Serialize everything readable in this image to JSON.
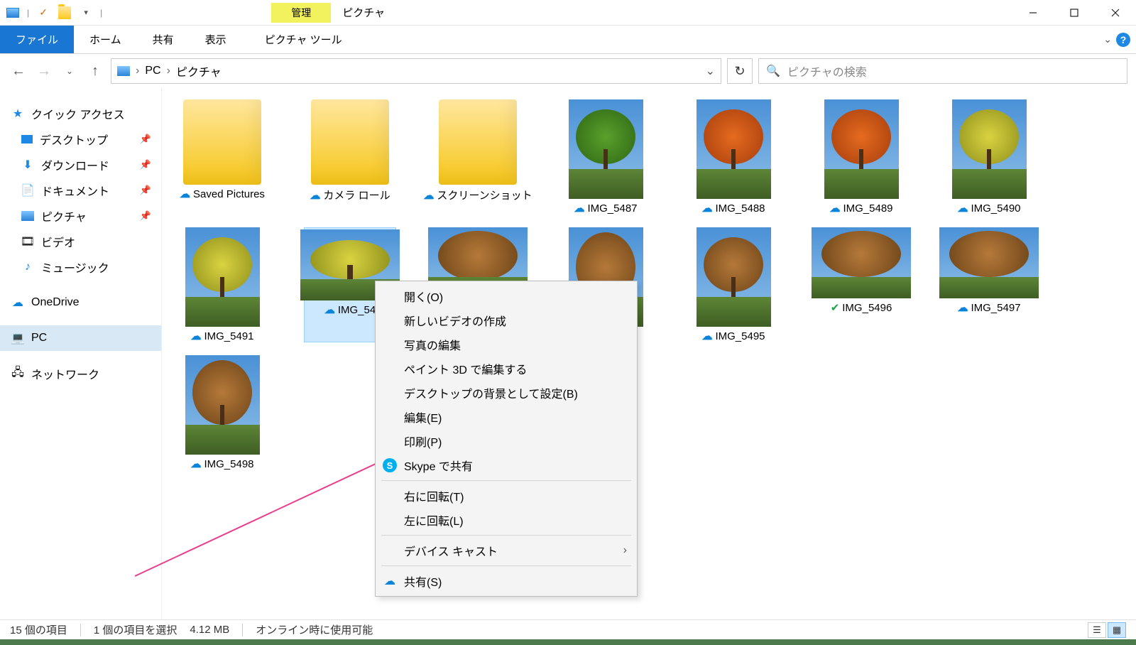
{
  "window": {
    "title": "ピクチャ",
    "contextual_tab": "管理",
    "tools_tab": "ピクチャ ツール"
  },
  "ribbon": {
    "file": "ファイル",
    "home": "ホーム",
    "share": "共有",
    "view": "表示"
  },
  "breadcrumb": {
    "pc": "PC",
    "folder": "ピクチャ"
  },
  "search": {
    "placeholder": "ピクチャの検索"
  },
  "sidebar": {
    "quick_access": "クイック アクセス",
    "desktop": "デスクトップ",
    "downloads": "ダウンロード",
    "documents": "ドキュメント",
    "pictures": "ピクチャ",
    "videos": "ビデオ",
    "music": "ミュージック",
    "onedrive": "OneDrive",
    "pc": "PC",
    "network": "ネットワーク"
  },
  "items": {
    "saved_pictures": "Saved Pictures",
    "camera_roll": "カメラ ロール",
    "screenshots": "スクリーンショット",
    "i5487": "IMG_5487",
    "i5488": "IMG_5488",
    "i5489": "IMG_5489",
    "i5490": "IMG_5490",
    "i5491": "IMG_5491",
    "i5492": "IMG_54",
    "i5495": "IMG_5495",
    "i5496": "IMG_5496",
    "i5497": "IMG_5497",
    "i5498": "IMG_5498"
  },
  "context": {
    "open": "開く(O)",
    "new_video": "新しいビデオの作成",
    "edit_photo": "写真の編集",
    "paint3d": "ペイント 3D で編集する",
    "set_bg": "デスクトップの背景として設定(B)",
    "edit": "編集(E)",
    "print": "印刷(P)",
    "skype": "Skype で共有",
    "rotate_right": "右に回転(T)",
    "rotate_left": "左に回転(L)",
    "cast": "デバイス キャスト",
    "share": "共有(S)"
  },
  "status": {
    "count": "15 個の項目",
    "selected": "1 個の項目を選択",
    "size": "4.12 MB",
    "online": "オンライン時に使用可能"
  }
}
